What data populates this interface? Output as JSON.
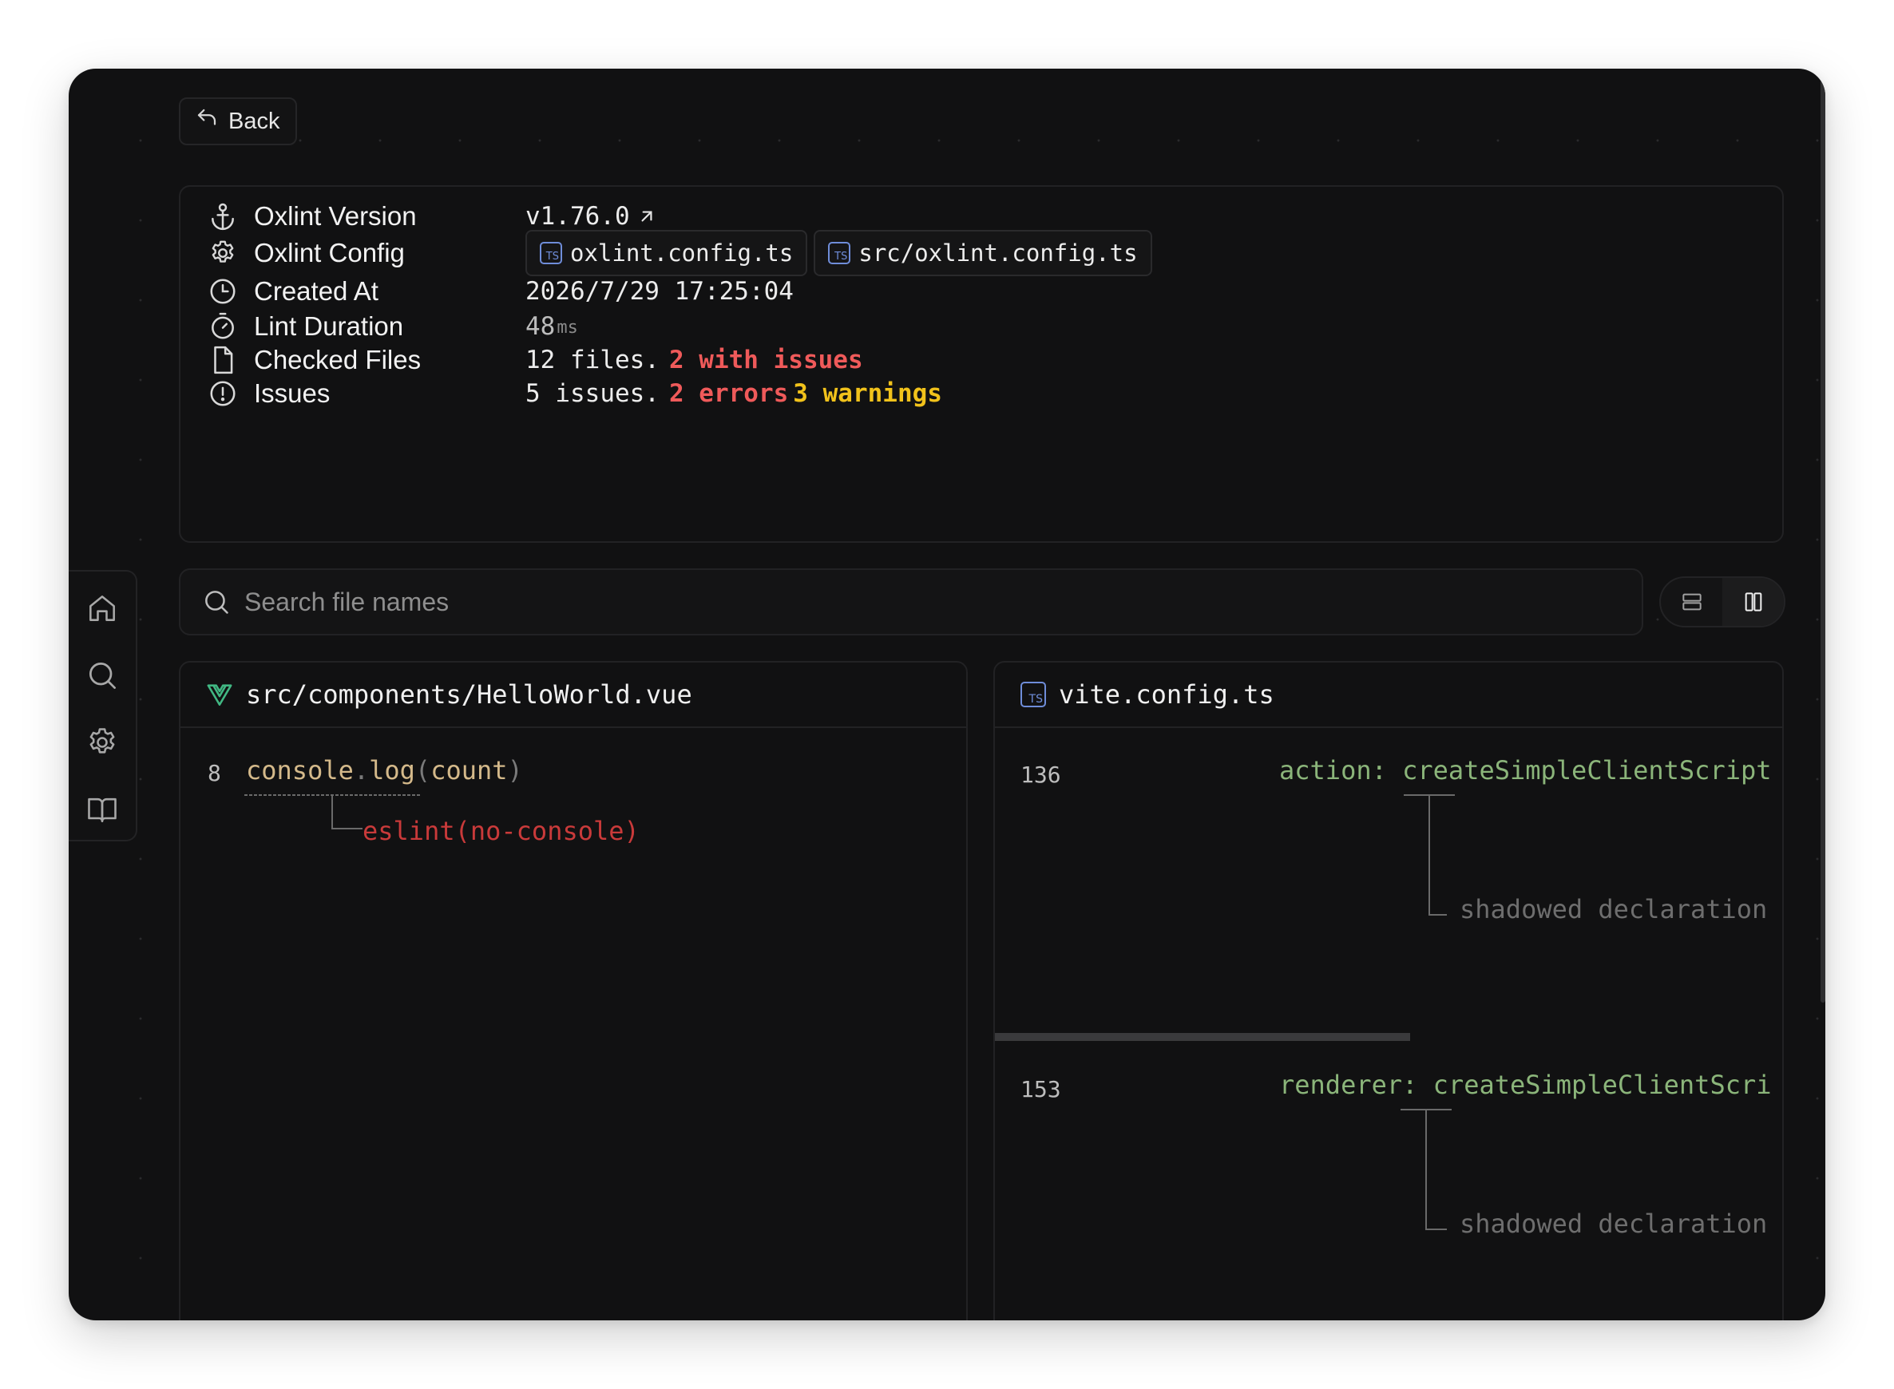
{
  "back_button": {
    "label": "Back"
  },
  "info": {
    "version": {
      "label": "Oxlint Version",
      "value": "v1.76.0"
    },
    "config": {
      "label": "Oxlint Config",
      "files": [
        "oxlint.config.ts",
        "src/oxlint.config.ts"
      ]
    },
    "created_at": {
      "label": "Created At",
      "value": "2026/7/29 17:25:04"
    },
    "duration": {
      "label": "Lint Duration",
      "value": "48",
      "unit": "ms"
    },
    "checked_files": {
      "label": "Checked Files",
      "count_text": "12 files.",
      "issues_text": "2 with issues"
    },
    "issues": {
      "label": "Issues",
      "count_text": "5 issues.",
      "errors_text": "2 errors",
      "warnings_text": "3 warnings"
    }
  },
  "search": {
    "placeholder": "Search file names"
  },
  "view_toggle": {
    "options": [
      "list-view",
      "split-view"
    ],
    "selected": "split-view"
  },
  "panels": {
    "left": {
      "file": "src/components/HelloWorld.vue",
      "file_icon": "vue-icon",
      "line_number": "8",
      "code": {
        "obj": "console",
        "dot": ".",
        "fn": "log",
        "open": "(",
        "arg": "count",
        "close": ")"
      },
      "diagnostic": "eslint(no-console)"
    },
    "right": {
      "file": "vite.config.ts",
      "file_icon": "ts-icon",
      "ts_badge": "TS",
      "snippets": [
        {
          "line_number": "136",
          "key": "action:",
          "value": "createSimpleClientScript",
          "diagnostic": "shadowed declaration"
        },
        {
          "line_number": "153",
          "key": "renderer:",
          "value": "createSimpleClientScri",
          "diagnostic": "shadowed declaration"
        }
      ]
    }
  },
  "colors": {
    "error": "#ef5a5a",
    "warning": "#f1c21b",
    "code_green": "#8bb57a",
    "ts_blue": "#6f8dd9",
    "vue_green": "#41b883"
  }
}
